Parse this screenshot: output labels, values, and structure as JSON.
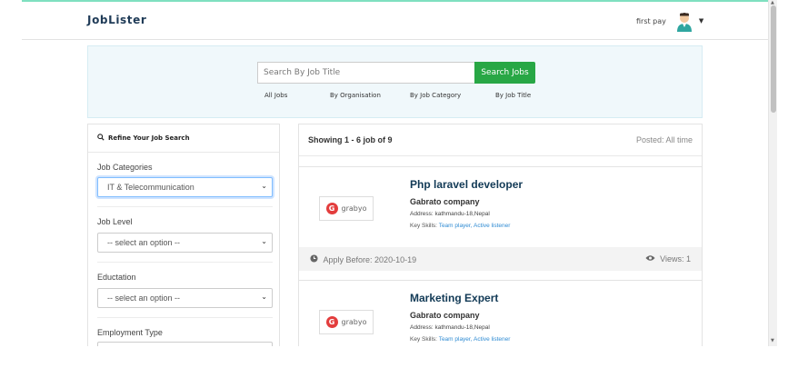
{
  "navbar": {
    "brand": "JobLister",
    "user_name": "first pay",
    "caret": "▼"
  },
  "search": {
    "placeholder": "Search By Job Title",
    "button_label": "Search Jobs",
    "links": [
      "All Jobs",
      "By Organisation",
      "By Job Category",
      "By Job Title"
    ]
  },
  "sidebar": {
    "heading": "Refine Your Job Search",
    "filters": [
      {
        "label": "Job Categories",
        "value": "IT & Telecommunication"
      },
      {
        "label": "Job Level",
        "value": "-- select an option --"
      },
      {
        "label": "Eductation",
        "value": "-- select an option --"
      },
      {
        "label": "Employment Type",
        "value": ""
      }
    ]
  },
  "results": {
    "count_text": "Showing 1 - 6 job of 9",
    "posted_text": "Posted: All time",
    "jobs": [
      {
        "title": "Php laravel developer",
        "company": "Gabrato company",
        "address": "Address: kathmandu-18,Nepal",
        "skills_label": "Key Skills:",
        "skills": "Team player, Active listener",
        "logo_text": "grabyo",
        "apply_before": "Apply Before: 2020-10-19",
        "views": "Views: 1"
      },
      {
        "title": "Marketing Expert",
        "company": "Gabrato company",
        "address": "Address: kathmandu-18,Nepal",
        "skills_label": "Key Skills:",
        "skills": "Team player, Active listener",
        "logo_text": "grabyo",
        "apply_before": "",
        "views": ""
      }
    ]
  },
  "colors": {
    "brand": "#1f3b57",
    "search_button": "#28a745",
    "job_title": "#123a56",
    "skills_link": "#2f8bd3"
  }
}
